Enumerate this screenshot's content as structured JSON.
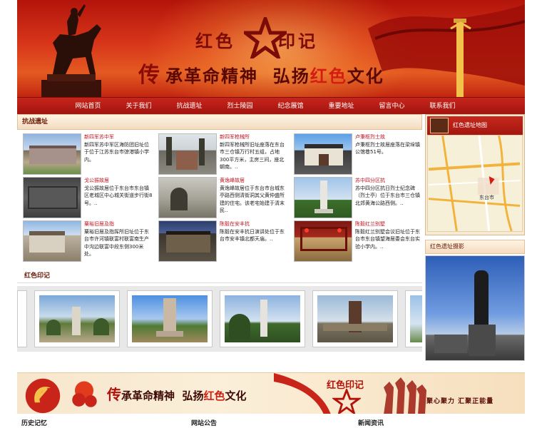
{
  "banner": {
    "title_left": "红色",
    "title_right": "印记",
    "slogan_chuan": "传",
    "slogan_a": "承革命精神",
    "slogan_b": "弘扬",
    "slogan_hot": "红色",
    "slogan_c": "文化",
    "colors": {
      "deep_red": "#a11510",
      "gold": "#f3c24a"
    }
  },
  "nav": {
    "items": [
      "网站首页",
      "关于我们",
      "抗战遗址",
      "烈士陵园",
      "纪念展馆",
      "重要地址",
      "留言中心",
      "联系我们"
    ]
  },
  "section_sites": {
    "heading": "抗战遗址",
    "items": [
      {
        "title": "新四军苏中军",
        "desc": "新四军苏中军区海防团旧址位于位于江苏东台市弶港镇小学内。"
      },
      {
        "title": "新四军枪械所",
        "desc": "新四军枪械所旧址座落在东台市三仓镇万行村五组，占地300平方米，主房三间，座北朝南。.."
      },
      {
        "title": "卢秉枢烈士故",
        "desc": "卢秉枢烈士故居座落在梁垛镇公馆巷51号。"
      },
      {
        "title": "戈公振故居",
        "desc": "戈公振故居位于东台市东台镇区老城区中心城关街道步行街8号。.."
      },
      {
        "title": "黄逸峰故居",
        "desc": "黄逸峰故居位于东台市台城东亭路西侧清街洞其父黄仲盛所建的住宅。该老宅始建于清末民.."
      },
      {
        "title": "苏中四分区抗",
        "desc": "苏中四分区抗日烈士纪念碑（烈士亭）位于东台市三仓镇北郊黄海公路西侧。.."
      },
      {
        "title": "粟裕旧居及指",
        "desc": "粟裕旧居及指挥所旧址位于东台市许河镇联富村联富南生产中沟边联富中段东侧300米处。"
      },
      {
        "title": "陈毅在安丰抗",
        "desc": "陈毅在安丰抗日演讲处位于东台市安丰镇北都天庙。.."
      },
      {
        "title": "陈毅红兰别墅",
        "desc": "陈毅红兰别墅会议旧址位于东台市东台镇望海居委会东台实验小学内。.."
      }
    ]
  },
  "section_imprint": {
    "heading": "红色印记"
  },
  "right": {
    "map_heading": "红色遗址地图",
    "map_city": "东台市",
    "photo_heading": "红色遗址摄影"
  },
  "bottom_banner": {
    "slogan_chuan": "传",
    "slogan_a": "承革命精神",
    "slogan_b": "弘扬",
    "slogan_hot": "红色",
    "slogan_c": "文化",
    "title": "红色印记",
    "motto": "聚心聚力 汇聚正能量"
  },
  "footer": {
    "col1": "历史记忆",
    "col2": "网站公告",
    "col3": "新闻资讯"
  }
}
